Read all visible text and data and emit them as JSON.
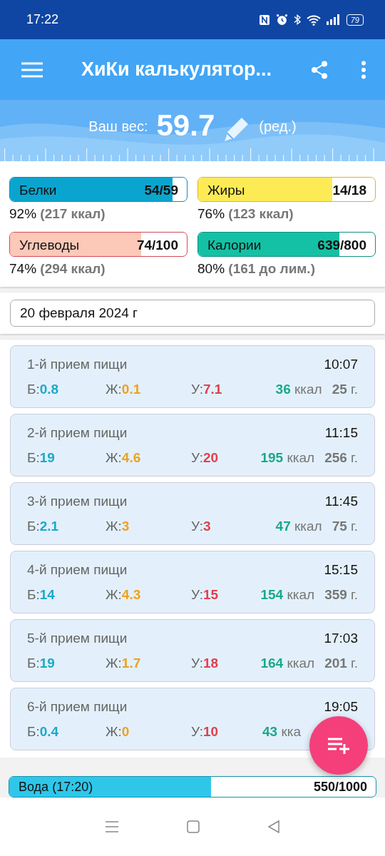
{
  "status_bar": {
    "time": "17:22",
    "battery": "79"
  },
  "app_bar": {
    "title": "ХиКи калькулятор..."
  },
  "weight": {
    "label": "Ваш вес:",
    "value": "59.7",
    "edit": "(ред.)"
  },
  "macros": [
    {
      "kind": "protein",
      "name": "Белки",
      "amount": "54/59",
      "level": 0.92,
      "percent": "92%",
      "note": "(217 ккал)"
    },
    {
      "kind": "fat",
      "name": "Жиры",
      "amount": "14/18",
      "level": 0.76,
      "percent": "76%",
      "note": "(123 ккал)"
    },
    {
      "kind": "carbs",
      "name": "Углеводы",
      "amount": "74/100",
      "level": 0.74,
      "percent": "74%",
      "note": "(294 ккал)"
    },
    {
      "kind": "calories",
      "name": "Калории",
      "amount": "639/800",
      "level": 0.8,
      "percent": "80%",
      "note": "(161 до лим.)"
    }
  ],
  "date": "20 февраля 2024 г",
  "meals": [
    {
      "title": "1-й прием пищи",
      "time": "10:07",
      "p_label": "Б:",
      "p": "0.8",
      "f_label": "Ж:",
      "f": "0.1",
      "c_label": "У:",
      "c": "7.1",
      "kcal": "36",
      "kcal_unit": "ккал",
      "grams": "25",
      "grams_unit": "г."
    },
    {
      "title": "2-й прием пищи",
      "time": "11:15",
      "p_label": "Б:",
      "p": "19",
      "f_label": "Ж:",
      "f": "4.6",
      "c_label": "У:",
      "c": "20",
      "kcal": "195",
      "kcal_unit": "ккал",
      "grams": "256",
      "grams_unit": "г."
    },
    {
      "title": "3-й прием пищи",
      "time": "11:45",
      "p_label": "Б:",
      "p": "2.1",
      "f_label": "Ж:",
      "f": "3",
      "c_label": "У:",
      "c": "3",
      "kcal": "47",
      "kcal_unit": "ккал",
      "grams": "75",
      "grams_unit": "г."
    },
    {
      "title": "4-й прием пищи",
      "time": "15:15",
      "p_label": "Б:",
      "p": "14",
      "f_label": "Ж:",
      "f": "4.3",
      "c_label": "У:",
      "c": "15",
      "kcal": "154",
      "kcal_unit": "ккал",
      "grams": "359",
      "grams_unit": "г."
    },
    {
      "title": "5-й прием пищи",
      "time": "17:03",
      "p_label": "Б:",
      "p": "19",
      "f_label": "Ж:",
      "f": "1.7",
      "c_label": "У:",
      "c": "18",
      "kcal": "164",
      "kcal_unit": "ккал",
      "grams": "201",
      "grams_unit": "г."
    },
    {
      "title": "6-й прием пищи",
      "time": "19:05",
      "p_label": "Б:",
      "p": "0.4",
      "f_label": "Ж:",
      "f": "0",
      "c_label": "У:",
      "c": "10",
      "kcal": "43",
      "kcal_unit": "кка"
    }
  ],
  "water": {
    "label": "Вода (17:20)",
    "amount": "550/1000",
    "level": 0.55
  }
}
